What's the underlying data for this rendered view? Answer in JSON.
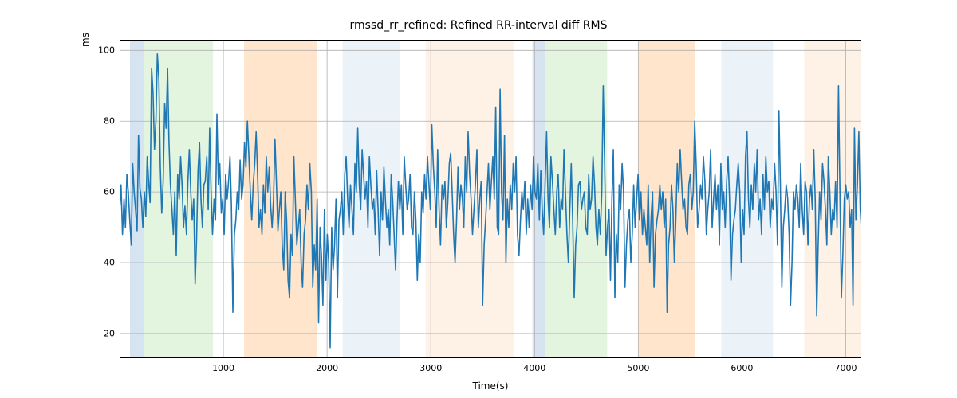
{
  "chart_data": {
    "type": "line",
    "title": "rmssd_rr_refined: Refined RR-interval diff RMS",
    "xlabel": "Time(s)",
    "ylabel": "ms",
    "xlim": [
      0,
      7150
    ],
    "ylim": [
      13,
      103
    ],
    "xticks": [
      1000,
      2000,
      3000,
      4000,
      5000,
      6000,
      7000
    ],
    "yticks": [
      20,
      40,
      60,
      80,
      100
    ],
    "series_color": "#1f77b4",
    "spans": [
      {
        "x0": 100,
        "x1": 230,
        "color": "#b3cde3",
        "alpha": 0.55
      },
      {
        "x0": 230,
        "x1": 900,
        "color": "#ccebc5",
        "alpha": 0.55
      },
      {
        "x0": 1200,
        "x1": 1900,
        "color": "#fdd0a2",
        "alpha": 0.55
      },
      {
        "x0": 2150,
        "x1": 2700,
        "color": "#dbeaf4",
        "alpha": 0.55
      },
      {
        "x0": 2950,
        "x1": 3800,
        "color": "#fde6cf",
        "alpha": 0.55
      },
      {
        "x0": 3980,
        "x1": 4100,
        "color": "#b3cde3",
        "alpha": 0.55
      },
      {
        "x0": 4100,
        "x1": 4700,
        "color": "#ccebc5",
        "alpha": 0.55
      },
      {
        "x0": 5000,
        "x1": 5550,
        "color": "#fdd0a2",
        "alpha": 0.55
      },
      {
        "x0": 5800,
        "x1": 6300,
        "color": "#dbeaf4",
        "alpha": 0.55
      },
      {
        "x0": 6600,
        "x1": 7150,
        "color": "#fde6cf",
        "alpha": 0.55
      }
    ],
    "x": [
      0,
      14,
      28,
      42,
      56,
      70,
      84,
      98,
      112,
      126,
      140,
      154,
      168,
      182,
      196,
      210,
      224,
      238,
      252,
      266,
      280,
      294,
      308,
      322,
      336,
      350,
      364,
      378,
      392,
      406,
      420,
      434,
      448,
      462,
      476,
      490,
      504,
      518,
      532,
      546,
      560,
      574,
      588,
      602,
      616,
      630,
      644,
      658,
      672,
      686,
      700,
      714,
      728,
      742,
      756,
      770,
      784,
      798,
      812,
      826,
      840,
      854,
      868,
      882,
      896,
      910,
      924,
      938,
      952,
      966,
      980,
      994,
      1008,
      1022,
      1036,
      1050,
      1064,
      1078,
      1092,
      1106,
      1120,
      1134,
      1148,
      1162,
      1176,
      1190,
      1204,
      1218,
      1232,
      1246,
      1260,
      1274,
      1288,
      1302,
      1316,
      1330,
      1344,
      1358,
      1372,
      1386,
      1400,
      1414,
      1428,
      1442,
      1456,
      1470,
      1484,
      1498,
      1512,
      1526,
      1540,
      1554,
      1568,
      1582,
      1596,
      1610,
      1624,
      1638,
      1652,
      1666,
      1680,
      1694,
      1708,
      1722,
      1736,
      1750,
      1764,
      1778,
      1792,
      1806,
      1820,
      1834,
      1848,
      1862,
      1876,
      1890,
      1904,
      1918,
      1932,
      1946,
      1960,
      1974,
      1988,
      2002,
      2016,
      2030,
      2044,
      2058,
      2072,
      2086,
      2100,
      2114,
      2128,
      2142,
      2156,
      2170,
      2184,
      2198,
      2212,
      2226,
      2240,
      2254,
      2268,
      2282,
      2296,
      2310,
      2324,
      2338,
      2352,
      2366,
      2380,
      2394,
      2408,
      2422,
      2436,
      2450,
      2464,
      2478,
      2492,
      2506,
      2520,
      2534,
      2548,
      2562,
      2576,
      2590,
      2604,
      2618,
      2632,
      2646,
      2660,
      2674,
      2688,
      2702,
      2716,
      2730,
      2744,
      2758,
      2772,
      2786,
      2800,
      2814,
      2828,
      2842,
      2856,
      2870,
      2884,
      2898,
      2912,
      2926,
      2940,
      2954,
      2968,
      2982,
      2996,
      3010,
      3024,
      3038,
      3052,
      3066,
      3080,
      3094,
      3108,
      3122,
      3136,
      3150,
      3164,
      3178,
      3192,
      3206,
      3220,
      3234,
      3248,
      3262,
      3276,
      3290,
      3304,
      3318,
      3332,
      3346,
      3360,
      3374,
      3388,
      3402,
      3416,
      3430,
      3444,
      3458,
      3472,
      3486,
      3500,
      3514,
      3528,
      3542,
      3556,
      3570,
      3584,
      3598,
      3612,
      3626,
      3640,
      3654,
      3668,
      3682,
      3696,
      3710,
      3724,
      3738,
      3752,
      3766,
      3780,
      3794,
      3808,
      3822,
      3836,
      3850,
      3864,
      3878,
      3892,
      3906,
      3920,
      3934,
      3948,
      3962,
      3976,
      3990,
      4004,
      4018,
      4032,
      4046,
      4060,
      4074,
      4088,
      4102,
      4116,
      4130,
      4144,
      4158,
      4172,
      4186,
      4200,
      4214,
      4228,
      4242,
      4256,
      4270,
      4284,
      4298,
      4312,
      4326,
      4340,
      4354,
      4368,
      4382,
      4396,
      4410,
      4424,
      4438,
      4452,
      4466,
      4480,
      4494,
      4508,
      4522,
      4536,
      4550,
      4564,
      4578,
      4592,
      4606,
      4620,
      4634,
      4648,
      4662,
      4676,
      4690,
      4704,
      4718,
      4732,
      4746,
      4760,
      4774,
      4788,
      4802,
      4816,
      4830,
      4844,
      4858,
      4872,
      4886,
      4900,
      4914,
      4928,
      4942,
      4956,
      4970,
      4984,
      4998,
      5012,
      5026,
      5040,
      5054,
      5068,
      5082,
      5096,
      5110,
      5124,
      5138,
      5152,
      5166,
      5180,
      5194,
      5208,
      5222,
      5236,
      5250,
      5264,
      5278,
      5292,
      5306,
      5320,
      5334,
      5348,
      5362,
      5376,
      5390,
      5404,
      5418,
      5432,
      5446,
      5460,
      5474,
      5488,
      5502,
      5516,
      5530,
      5544,
      5558,
      5572,
      5586,
      5600,
      5614,
      5628,
      5642,
      5656,
      5670,
      5684,
      5698,
      5712,
      5726,
      5740,
      5754,
      5768,
      5782,
      5796,
      5810,
      5824,
      5838,
      5852,
      5866,
      5880,
      5894,
      5908,
      5922,
      5936,
      5950,
      5964,
      5978,
      5992,
      6006,
      6020,
      6034,
      6048,
      6062,
      6076,
      6090,
      6104,
      6118,
      6132,
      6146,
      6160,
      6174,
      6188,
      6202,
      6216,
      6230,
      6244,
      6258,
      6272,
      6286,
      6300,
      6314,
      6328,
      6342,
      6356,
      6370,
      6384,
      6398,
      6412,
      6426,
      6440,
      6454,
      6468,
      6482,
      6496,
      6510,
      6524,
      6538,
      6552,
      6566,
      6580,
      6594,
      6608,
      6622,
      6636,
      6650,
      6664,
      6678,
      6692,
      6706,
      6720,
      6734,
      6748,
      6762,
      6776,
      6790,
      6804,
      6818,
      6832,
      6846,
      6860,
      6874,
      6888,
      6902,
      6916,
      6930,
      6944,
      6958,
      6972,
      6986,
      7000,
      7014,
      7028,
      7042,
      7056,
      7070,
      7084,
      7098,
      7112,
      7126,
      7140,
      7150
    ],
    "values": [
      55,
      62,
      48,
      58,
      50,
      65,
      60,
      52,
      45,
      68,
      60,
      55,
      49,
      76,
      61,
      58,
      50,
      60,
      53,
      70,
      63,
      57,
      95,
      88,
      72,
      80,
      99,
      92,
      67,
      54,
      63,
      85,
      78,
      95,
      74,
      62,
      55,
      48,
      60,
      42,
      65,
      58,
      70,
      62,
      50,
      56,
      48,
      63,
      72,
      60,
      52,
      58,
      34,
      47,
      66,
      74,
      58,
      50,
      62,
      63,
      70,
      55,
      78,
      60,
      48,
      58,
      52,
      82,
      62,
      68,
      54,
      58,
      48,
      65,
      58,
      63,
      70,
      56,
      26,
      48,
      52,
      60,
      55,
      69,
      58,
      62,
      74,
      67,
      80,
      70,
      60,
      52,
      62,
      68,
      77,
      65,
      50,
      55,
      48,
      62,
      54,
      70,
      60,
      67,
      56,
      50,
      58,
      75,
      62,
      49,
      55,
      60,
      45,
      38,
      60,
      52,
      35,
      30,
      48,
      42,
      70,
      58,
      45,
      50,
      55,
      40,
      33,
      48,
      52,
      62,
      55,
      68,
      60,
      33,
      45,
      38,
      58,
      23,
      50,
      42,
      28,
      55,
      35,
      48,
      40,
      16,
      50,
      38,
      45,
      58,
      30,
      52,
      55,
      60,
      48,
      65,
      70,
      58,
      50,
      62,
      55,
      48,
      68,
      60,
      78,
      62,
      55,
      72,
      65,
      58,
      63,
      50,
      70,
      62,
      55,
      58,
      48,
      66,
      55,
      42,
      60,
      52,
      67,
      58,
      50,
      55,
      45,
      65,
      58,
      48,
      38,
      52,
      63,
      55,
      62,
      48,
      70,
      62,
      55,
      58,
      65,
      50,
      48,
      60,
      52,
      35,
      48,
      40,
      60,
      54,
      65,
      58,
      70,
      62,
      55,
      79,
      68,
      60,
      50,
      72,
      55,
      45,
      62,
      58,
      63,
      50,
      57,
      68,
      71,
      60,
      48,
      40,
      52,
      67,
      55,
      62,
      58,
      50,
      70,
      60,
      77,
      65,
      58,
      48,
      55,
      62,
      72,
      50,
      58,
      63,
      28,
      45,
      52,
      60,
      68,
      55,
      63,
      70,
      58,
      84,
      50,
      48,
      89,
      60,
      52,
      76,
      40,
      58,
      50,
      62,
      55,
      68,
      60,
      70,
      48,
      42,
      52,
      60,
      55,
      63,
      48,
      58,
      50,
      62,
      55,
      70,
      60,
      58,
      68,
      52,
      66,
      55,
      48,
      62,
      77,
      58,
      50,
      70,
      63,
      55,
      48,
      60,
      65,
      50,
      58,
      55,
      72,
      60,
      48,
      40,
      55,
      68,
      52,
      30,
      45,
      50,
      62,
      63,
      55,
      58,
      60,
      50,
      48,
      65,
      55,
      58,
      70,
      62,
      50,
      45,
      55,
      48,
      60,
      90,
      68,
      42,
      50,
      55,
      35,
      58,
      72,
      30,
      48,
      40,
      62,
      55,
      68,
      60,
      33,
      45,
      52,
      55,
      40,
      48,
      62,
      50,
      58,
      65,
      52,
      60,
      48,
      55,
      50,
      45,
      62,
      40,
      53,
      60,
      33,
      48,
      52,
      55,
      62,
      55,
      60,
      50,
      58,
      26,
      45,
      50,
      62,
      55,
      40,
      52,
      68,
      60,
      72,
      63,
      55,
      58,
      50,
      48,
      62,
      65,
      55,
      60,
      80,
      68,
      50,
      55,
      62,
      58,
      70,
      63,
      48,
      55,
      60,
      72,
      50,
      58,
      65,
      55,
      62,
      45,
      68,
      55,
      60,
      50,
      63,
      70,
      58,
      35,
      48,
      52,
      55,
      62,
      68,
      60,
      40,
      55,
      48,
      70,
      77,
      58,
      50,
      62,
      55,
      68,
      60,
      72,
      52,
      58,
      48,
      65,
      55,
      70,
      60,
      63,
      50,
      58,
      55,
      68,
      60,
      45,
      83,
      62,
      33,
      50,
      55,
      62,
      58,
      48,
      28,
      40,
      60,
      55,
      62,
      58,
      50,
      68,
      55,
      48,
      63,
      60,
      45,
      58,
      62,
      55,
      72,
      58,
      25,
      45,
      60,
      52,
      68,
      63,
      55,
      45,
      70,
      60,
      48,
      55,
      52,
      63,
      50,
      90,
      60,
      30,
      42,
      58,
      62,
      58,
      60,
      50,
      55,
      28,
      78,
      52,
      62,
      77,
      55,
      50,
      60
    ]
  }
}
